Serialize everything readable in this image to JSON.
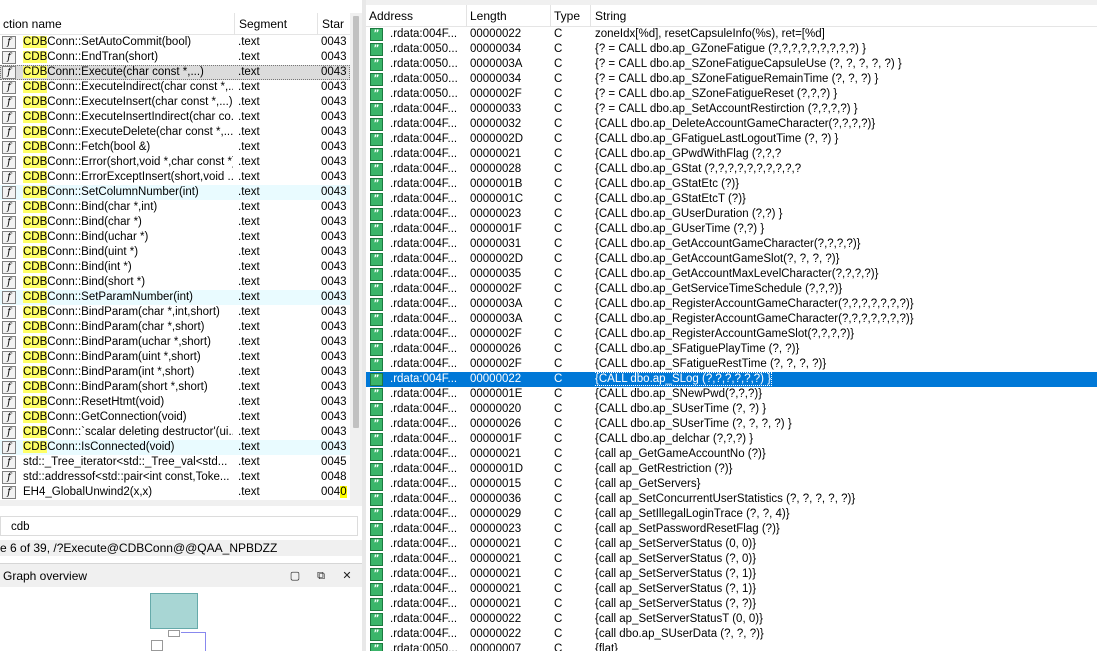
{
  "functions": {
    "columns": {
      "name": "ction name",
      "segment": "Segment",
      "start": "Star"
    },
    "rows": [
      {
        "pre": "",
        "hl": "CDB",
        "post": "Conn::SetAutoCommit(bool)",
        "segment": ".text",
        "start": "0043",
        "alt": false,
        "selected": false
      },
      {
        "pre": "",
        "hl": "CDB",
        "post": "Conn::EndTran(short)",
        "segment": ".text",
        "start": "0043",
        "alt": false,
        "selected": false
      },
      {
        "pre": "",
        "hl": "CDB",
        "post": "Conn::Execute(char const *,...)",
        "segment": ".text",
        "start": "0043",
        "alt": false,
        "selected": true
      },
      {
        "pre": "",
        "hl": "CDB",
        "post": "Conn::ExecuteIndirect(char const *,...",
        "segment": ".text",
        "start": "0043",
        "alt": false,
        "selected": false
      },
      {
        "pre": "",
        "hl": "CDB",
        "post": "Conn::ExecuteInsert(char const *,...)",
        "segment": ".text",
        "start": "0043",
        "alt": false,
        "selected": false
      },
      {
        "pre": "",
        "hl": "CDB",
        "post": "Conn::ExecuteInsertIndirect(char co...",
        "segment": ".text",
        "start": "0043",
        "alt": false,
        "selected": false
      },
      {
        "pre": "",
        "hl": "CDB",
        "post": "Conn::ExecuteDelete(char const *,...)",
        "segment": ".text",
        "start": "0043",
        "alt": false,
        "selected": false
      },
      {
        "pre": "",
        "hl": "CDB",
        "post": "Conn::Fetch(bool &)",
        "segment": ".text",
        "start": "0043",
        "alt": false,
        "selected": false
      },
      {
        "pre": "",
        "hl": "CDB",
        "post": "Conn::Error(short,void *,char const *)",
        "segment": ".text",
        "start": "0043",
        "alt": false,
        "selected": false
      },
      {
        "pre": "",
        "hl": "CDB",
        "post": "Conn::ErrorExceptInsert(short,void ...",
        "segment": ".text",
        "start": "0043",
        "alt": false,
        "selected": false
      },
      {
        "pre": "",
        "hl": "CDB",
        "post": "Conn::SetColumnNumber(int)",
        "segment": ".text",
        "start": "0043",
        "alt": true,
        "selected": false
      },
      {
        "pre": "",
        "hl": "CDB",
        "post": "Conn::Bind(char *,int)",
        "segment": ".text",
        "start": "0043",
        "alt": false,
        "selected": false
      },
      {
        "pre": "",
        "hl": "CDB",
        "post": "Conn::Bind(char *)",
        "segment": ".text",
        "start": "0043",
        "alt": false,
        "selected": false
      },
      {
        "pre": "",
        "hl": "CDB",
        "post": "Conn::Bind(uchar *)",
        "segment": ".text",
        "start": "0043",
        "alt": false,
        "selected": false
      },
      {
        "pre": "",
        "hl": "CDB",
        "post": "Conn::Bind(uint *)",
        "segment": ".text",
        "start": "0043",
        "alt": false,
        "selected": false
      },
      {
        "pre": "",
        "hl": "CDB",
        "post": "Conn::Bind(int *)",
        "segment": ".text",
        "start": "0043",
        "alt": false,
        "selected": false
      },
      {
        "pre": "",
        "hl": "CDB",
        "post": "Conn::Bind(short *)",
        "segment": ".text",
        "start": "0043",
        "alt": false,
        "selected": false
      },
      {
        "pre": "",
        "hl": "CDB",
        "post": "Conn::SetParamNumber(int)",
        "segment": ".text",
        "start": "0043",
        "alt": true,
        "selected": false
      },
      {
        "pre": "",
        "hl": "CDB",
        "post": "Conn::BindParam(char *,int,short)",
        "segment": ".text",
        "start": "0043",
        "alt": false,
        "selected": false
      },
      {
        "pre": "",
        "hl": "CDB",
        "post": "Conn::BindParam(char *,short)",
        "segment": ".text",
        "start": "0043",
        "alt": false,
        "selected": false
      },
      {
        "pre": "",
        "hl": "CDB",
        "post": "Conn::BindParam(uchar *,short)",
        "segment": ".text",
        "start": "0043",
        "alt": false,
        "selected": false
      },
      {
        "pre": "",
        "hl": "CDB",
        "post": "Conn::BindParam(uint *,short)",
        "segment": ".text",
        "start": "0043",
        "alt": false,
        "selected": false
      },
      {
        "pre": "",
        "hl": "CDB",
        "post": "Conn::BindParam(int *,short)",
        "segment": ".text",
        "start": "0043",
        "alt": false,
        "selected": false
      },
      {
        "pre": "",
        "hl": "CDB",
        "post": "Conn::BindParam(short *,short)",
        "segment": ".text",
        "start": "0043",
        "alt": false,
        "selected": false
      },
      {
        "pre": "",
        "hl": "CDB",
        "post": "Conn::ResetHtmt(void)",
        "segment": ".text",
        "start": "0043",
        "alt": false,
        "selected": false
      },
      {
        "pre": "",
        "hl": "CDB",
        "post": "Conn::GetConnection(void)",
        "segment": ".text",
        "start": "0043",
        "alt": false,
        "selected": false
      },
      {
        "pre": "",
        "hl": "CDB",
        "post": "Conn::`scalar deleting destructor'(ui...",
        "segment": ".text",
        "start": "0043",
        "alt": false,
        "selected": false
      },
      {
        "pre": "",
        "hl": "CDB",
        "post": "Conn::IsConnected(void)",
        "segment": ".text",
        "start": "0043",
        "alt": true,
        "selected": false
      },
      {
        "pre": "std::_Tree_iterator<std::_Tree_val<std...",
        "hl": "",
        "post": "",
        "segment": ".text",
        "start": "0045",
        "alt": false,
        "selected": false
      },
      {
        "pre": "std::addressof<std::pair<int const,Toke...",
        "hl": "",
        "post": "",
        "segment": ".text",
        "start": "0048",
        "alt": false,
        "selected": false
      },
      {
        "pre": "EH4_GlobalUnwind2(x,x)",
        "hl": "",
        "post": "",
        "segment": ".text",
        "start": "0040",
        "alt": false,
        "selected": false,
        "start_hl": true
      }
    ]
  },
  "search": {
    "value": "cdb"
  },
  "status": {
    "text": "e 6 of 39, /?Execute@CDBConn@@QAA_NPBDZZ"
  },
  "graph": {
    "title": "Graph overview"
  },
  "strings": {
    "columns": {
      "address": "Address",
      "length": "Length",
      "type": "Type",
      "string": "String"
    },
    "rows": [
      {
        "address": ".rdata:004F...",
        "length": "00000022",
        "type": "C",
        "string": "zoneIdx[%d], resetCapsuleInfo(%s), ret=[%d]"
      },
      {
        "address": ".rdata:0050...",
        "length": "00000034",
        "type": "C",
        "string": "{? = CALL dbo.ap_GZoneFatigue (?,?,?,?,?,?,?,?,?) }"
      },
      {
        "address": ".rdata:0050...",
        "length": "0000003A",
        "type": "C",
        "string": "{? = CALL dbo.ap_SZoneFatigueCapsuleUse (?, ?, ?, ?, ?) }"
      },
      {
        "address": ".rdata:0050...",
        "length": "00000034",
        "type": "C",
        "string": "{? = CALL dbo.ap_SZoneFatigueRemainTime (?, ?, ?) }"
      },
      {
        "address": ".rdata:0050...",
        "length": "0000002F",
        "type": "C",
        "string": "{? = CALL dbo.ap_SZoneFatigueReset (?,?,?) }"
      },
      {
        "address": ".rdata:004F...",
        "length": "00000033",
        "type": "C",
        "string": "{? = CALL dbo.ap_SetAccountRestirction (?,?,?,?) }"
      },
      {
        "address": ".rdata:004F...",
        "length": "00000032",
        "type": "C",
        "string": "{CALL dbo.ap_DeleteAccountGameCharacter(?,?,?,?)}"
      },
      {
        "address": ".rdata:004F...",
        "length": "0000002D",
        "type": "C",
        "string": "{CALL dbo.ap_GFatigueLastLogoutTime (?, ?) }"
      },
      {
        "address": ".rdata:004F...",
        "length": "00000021",
        "type": "C",
        "string": "{CALL dbo.ap_GPwdWithFlag (?,?,?"
      },
      {
        "address": ".rdata:004F...",
        "length": "00000028",
        "type": "C",
        "string": "{CALL dbo.ap_GStat (?,?,?,?,?,?,?,?,?,?"
      },
      {
        "address": ".rdata:004F...",
        "length": "0000001B",
        "type": "C",
        "string": "{CALL dbo.ap_GStatEtc (?)}"
      },
      {
        "address": ".rdata:004F...",
        "length": "0000001C",
        "type": "C",
        "string": "{CALL dbo.ap_GStatEtcT (?)}"
      },
      {
        "address": ".rdata:004F...",
        "length": "00000023",
        "type": "C",
        "string": "{CALL dbo.ap_GUserDuration (?,?) }"
      },
      {
        "address": ".rdata:004F...",
        "length": "0000001F",
        "type": "C",
        "string": "{CALL dbo.ap_GUserTime (?,?) }"
      },
      {
        "address": ".rdata:004F...",
        "length": "00000031",
        "type": "C",
        "string": "{CALL dbo.ap_GetAccountGameCharacter(?,?,?,?)}"
      },
      {
        "address": ".rdata:004F...",
        "length": "0000002D",
        "type": "C",
        "string": "{CALL dbo.ap_GetAccountGameSlot(?, ?, ?, ?)}"
      },
      {
        "address": ".rdata:004F...",
        "length": "00000035",
        "type": "C",
        "string": "{CALL dbo.ap_GetAccountMaxLevelCharacter(?,?,?,?)}"
      },
      {
        "address": ".rdata:004F...",
        "length": "0000002F",
        "type": "C",
        "string": "{CALL dbo.ap_GetServiceTimeSchedule (?,?,?)}"
      },
      {
        "address": ".rdata:004F...",
        "length": "0000003A",
        "type": "C",
        "string": "{CALL dbo.ap_RegisterAccountGameCharacter(?,?,?,?,?,?,?)}"
      },
      {
        "address": ".rdata:004F...",
        "length": "0000003A",
        "type": "C",
        "string": "{CALL dbo.ap_RegisterAccountGameCharacter(?,?,?,?,?,?,?)}"
      },
      {
        "address": ".rdata:004F...",
        "length": "0000002F",
        "type": "C",
        "string": "{CALL dbo.ap_RegisterAccountGameSlot(?,?,?,?)}"
      },
      {
        "address": ".rdata:004F...",
        "length": "00000026",
        "type": "C",
        "string": "{CALL dbo.ap_SFatiguePlayTime (?, ?)}"
      },
      {
        "address": ".rdata:004F...",
        "length": "0000002F",
        "type": "C",
        "string": "{CALL dbo.ap_SFatigueRestTime (?, ?, ?, ?)}"
      },
      {
        "address": ".rdata:004F...",
        "length": "00000022",
        "type": "C",
        "string": "{CALL dbo.ap_SLog (?,?,?,?,?,?) }",
        "selected": true
      },
      {
        "address": ".rdata:004F...",
        "length": "0000001E",
        "type": "C",
        "string": "{CALL dbo.ap_SNewPwd(?,?,?)}"
      },
      {
        "address": ".rdata:004F...",
        "length": "00000020",
        "type": "C",
        "string": "{CALL dbo.ap_SUserTime (?, ?) }"
      },
      {
        "address": ".rdata:004F...",
        "length": "00000026",
        "type": "C",
        "string": "{CALL dbo.ap_SUserTime (?, ?, ?, ?) }"
      },
      {
        "address": ".rdata:004F...",
        "length": "0000001F",
        "type": "C",
        "string": "{CALL dbo.ap_delchar (?,?,?) }"
      },
      {
        "address": ".rdata:004F...",
        "length": "00000021",
        "type": "C",
        "string": "{call ap_GetGameAccountNo (?)}"
      },
      {
        "address": ".rdata:004F...",
        "length": "0000001D",
        "type": "C",
        "string": "{call ap_GetRestriction (?)}"
      },
      {
        "address": ".rdata:004F...",
        "length": "00000015",
        "type": "C",
        "string": "{call ap_GetServers}"
      },
      {
        "address": ".rdata:004F...",
        "length": "00000036",
        "type": "C",
        "string": "{call ap_SetConcurrentUserStatistics (?, ?, ?, ?, ?)}"
      },
      {
        "address": ".rdata:004F...",
        "length": "00000029",
        "type": "C",
        "string": "{call ap_SetIllegalLoginTrace (?, ?, 4)}"
      },
      {
        "address": ".rdata:004F...",
        "length": "00000023",
        "type": "C",
        "string": "{call ap_SetPasswordResetFlag (?)}"
      },
      {
        "address": ".rdata:004F...",
        "length": "00000021",
        "type": "C",
        "string": "{call ap_SetServerStatus (0, 0)}"
      },
      {
        "address": ".rdata:004F...",
        "length": "00000021",
        "type": "C",
        "string": "{call ap_SetServerStatus (?, 0)}"
      },
      {
        "address": ".rdata:004F...",
        "length": "00000021",
        "type": "C",
        "string": "{call ap_SetServerStatus (?, 1)}"
      },
      {
        "address": ".rdata:004F...",
        "length": "00000021",
        "type": "C",
        "string": "{call ap_SetServerStatus (?, 1)}"
      },
      {
        "address": ".rdata:004F...",
        "length": "00000021",
        "type": "C",
        "string": "{call ap_SetServerStatus (?, ?)}"
      },
      {
        "address": ".rdata:004F...",
        "length": "00000022",
        "type": "C",
        "string": "{call ap_SetServerStatusT (0, 0)}"
      },
      {
        "address": ".rdata:004F...",
        "length": "00000022",
        "type": "C",
        "string": "{call dbo.ap_SUserData (?, ?, ?)}"
      },
      {
        "address": ".rdata:0050...",
        "length": "00000007",
        "type": "C",
        "string": "{flat}"
      }
    ]
  },
  "colors": {
    "highlight": "#ffff66",
    "selection": "#0078d7",
    "alt_row": "#e9fbff",
    "string_icon": "#3bb56a"
  },
  "icons": {
    "function": "function-icon",
    "string": "string-icon"
  }
}
